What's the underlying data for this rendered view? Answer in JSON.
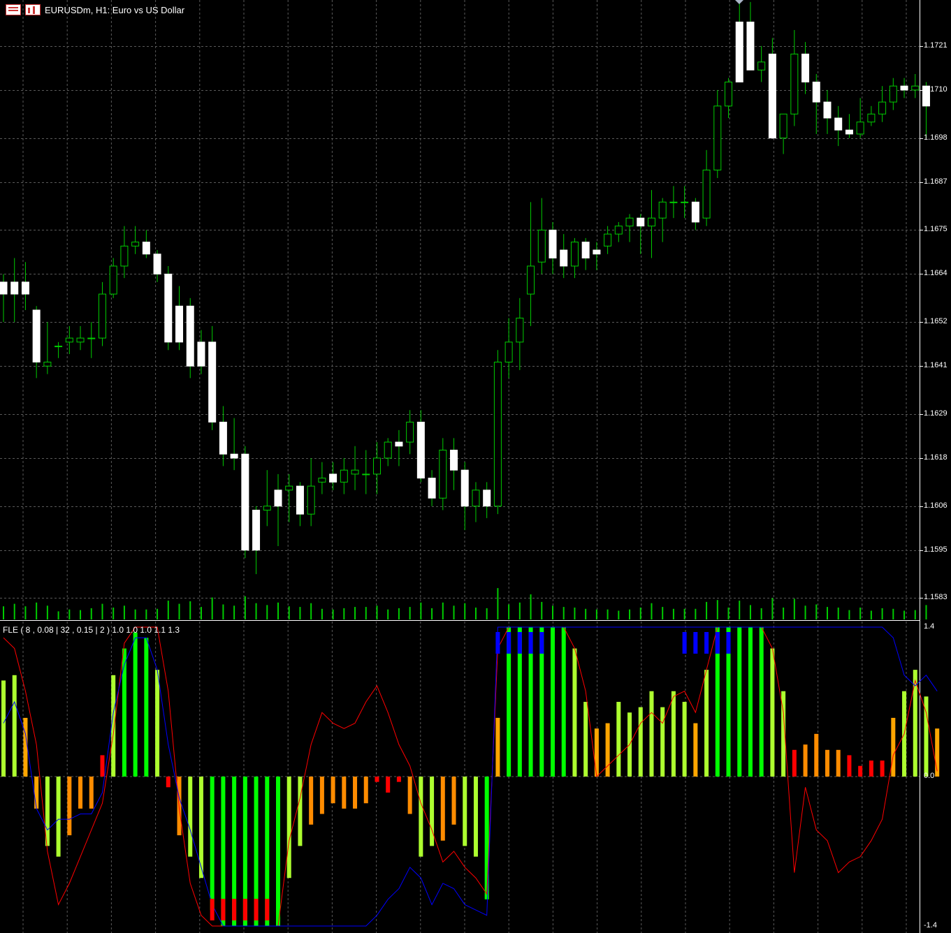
{
  "window": {
    "symbol": "EURUSDm",
    "timeframe": "H1",
    "title": "EURUSDm, H1:  Euro vs US Dollar"
  },
  "indicator": {
    "label": "FLE ( 8 , 0.08 | 32 , 0.15 | 2 ) 1.0 1.0 1.0 1.1 1.3",
    "axis": [
      "1.4",
      "0.0",
      "-1.4"
    ]
  },
  "price_axis": [
    "1.1721",
    "1.1710",
    "1.1698",
    "1.1687",
    "1.1675",
    "1.1664",
    "1.1652",
    "1.1641",
    "1.1629",
    "1.1618",
    "1.1606",
    "1.1595",
    "1.1583"
  ],
  "colors": {
    "background": "#000000",
    "grid": "#5a5a5a",
    "candle_up_body": "#000000",
    "candle_down_body": "#ffffff",
    "candle_wick": "#00cc00",
    "volume": "#00cc00",
    "hist_strong": "#00ff00",
    "hist_mid": "#adff2f",
    "hist_weak": "#ffa500",
    "hist_low": "#ff8c00",
    "hist_neg": "#ff0000",
    "line_red": "#ff0000",
    "line_blue": "#0000ff",
    "marker_buy": "#0000ff",
    "marker_sell": "#ff0000"
  },
  "chart_data": [
    {
      "type": "candlestick",
      "title": "EURUSDm, H1:  Euro vs US Dollar",
      "ylim": [
        1.15775,
        1.17325
      ],
      "y_ticks": [
        1.1721,
        1.171,
        1.1698,
        1.1687,
        1.1675,
        1.1664,
        1.1652,
        1.1641,
        1.1629,
        1.1618,
        1.1606,
        1.1595,
        1.1583
      ],
      "grid": true,
      "candles": [
        [
          1.1662,
          1.1664,
          1.1652,
          1.1659
        ],
        [
          1.1662,
          1.1668,
          1.1652,
          1.1659
        ],
        [
          1.1662,
          1.1667,
          1.1655,
          1.1659
        ],
        [
          1.1655,
          1.1656,
          1.1638,
          1.1642
        ],
        [
          1.1641,
          1.1652,
          1.1639,
          1.1642
        ],
        [
          1.1646,
          1.1647,
          1.1643,
          1.1646
        ],
        [
          1.1647,
          1.1651,
          1.1644,
          1.1648
        ],
        [
          1.1647,
          1.1651,
          1.1645,
          1.1648
        ],
        [
          1.1648,
          1.1652,
          1.1643,
          1.1648
        ],
        [
          1.1648,
          1.1662,
          1.1646,
          1.1659
        ],
        [
          1.1659,
          1.1668,
          1.1658,
          1.1666
        ],
        [
          1.1666,
          1.1676,
          1.1663,
          1.1671
        ],
        [
          1.1671,
          1.1676,
          1.1669,
          1.1672
        ],
        [
          1.1672,
          1.1675,
          1.1668,
          1.1669
        ],
        [
          1.1669,
          1.167,
          1.1662,
          1.1664
        ],
        [
          1.1664,
          1.1666,
          1.1645,
          1.1647
        ],
        [
          1.1656,
          1.1661,
          1.1645,
          1.1647
        ],
        [
          1.1656,
          1.1658,
          1.1638,
          1.1641
        ],
        [
          1.1647,
          1.165,
          1.1639,
          1.1641
        ],
        [
          1.1647,
          1.1651,
          1.1625,
          1.1627
        ],
        [
          1.1627,
          1.1631,
          1.1616,
          1.1619
        ],
        [
          1.1619,
          1.1628,
          1.1615,
          1.1618
        ],
        [
          1.1619,
          1.1621,
          1.1593,
          1.1595
        ],
        [
          1.1605,
          1.1606,
          1.1589,
          1.1595
        ],
        [
          1.1605,
          1.1615,
          1.1601,
          1.1606
        ],
        [
          1.161,
          1.1614,
          1.1596,
          1.1606
        ],
        [
          1.161,
          1.1614,
          1.1602,
          1.1611
        ],
        [
          1.1611,
          1.1612,
          1.1601,
          1.1604
        ],
        [
          1.1604,
          1.1618,
          1.1601,
          1.1611
        ],
        [
          1.1612,
          1.1617,
          1.1609,
          1.1613
        ],
        [
          1.1614,
          1.1617,
          1.161,
          1.1612
        ],
        [
          1.1612,
          1.1618,
          1.1609,
          1.1615
        ],
        [
          1.1614,
          1.1621,
          1.161,
          1.1615
        ],
        [
          1.1614,
          1.162,
          1.1609,
          1.1614
        ],
        [
          1.1614,
          1.1622,
          1.1609,
          1.1618
        ],
        [
          1.1618,
          1.1623,
          1.1616,
          1.1622
        ],
        [
          1.1622,
          1.1625,
          1.1616,
          1.1621
        ],
        [
          1.1622,
          1.163,
          1.1619,
          1.1627
        ],
        [
          1.1627,
          1.163,
          1.1612,
          1.1613
        ],
        [
          1.1613,
          1.1615,
          1.1606,
          1.1608
        ],
        [
          1.1608,
          1.1623,
          1.1605,
          1.162
        ],
        [
          1.162,
          1.1623,
          1.161,
          1.1615
        ],
        [
          1.1615,
          1.1617,
          1.16,
          1.1606
        ],
        [
          1.1606,
          1.1612,
          1.1602,
          1.161
        ],
        [
          1.161,
          1.1612,
          1.1603,
          1.1606
        ],
        [
          1.1606,
          1.1645,
          1.1604,
          1.1642
        ],
        [
          1.1642,
          1.1653,
          1.1638,
          1.1647
        ],
        [
          1.1647,
          1.1658,
          1.164,
          1.1653
        ],
        [
          1.1659,
          1.1682,
          1.1651,
          1.1666
        ],
        [
          1.1667,
          1.1683,
          1.1664,
          1.1675
        ],
        [
          1.1675,
          1.1677,
          1.1664,
          1.1668
        ],
        [
          1.167,
          1.1674,
          1.1663,
          1.1666
        ],
        [
          1.1666,
          1.1673,
          1.1663,
          1.1672
        ],
        [
          1.1672,
          1.1673,
          1.1665,
          1.1668
        ],
        [
          1.167,
          1.1672,
          1.1665,
          1.1669
        ],
        [
          1.1671,
          1.1676,
          1.1669,
          1.1674
        ],
        [
          1.1674,
          1.1677,
          1.1672,
          1.1676
        ],
        [
          1.1676,
          1.1679,
          1.1672,
          1.1678
        ],
        [
          1.1678,
          1.1679,
          1.1669,
          1.1676
        ],
        [
          1.1676,
          1.1685,
          1.1668,
          1.1678
        ],
        [
          1.1678,
          1.1683,
          1.1672,
          1.1682
        ],
        [
          1.1682,
          1.1686,
          1.1678,
          1.1682
        ],
        [
          1.1682,
          1.1686,
          1.1678,
          1.1682
        ],
        [
          1.1682,
          1.1683,
          1.1675,
          1.1677
        ],
        [
          1.1678,
          1.1695,
          1.1676,
          1.169
        ],
        [
          1.169,
          1.171,
          1.1688,
          1.1706
        ],
        [
          1.1706,
          1.1713,
          1.1703,
          1.1712
        ],
        [
          1.1727,
          1.1733,
          1.1712,
          1.1712
        ],
        [
          1.1727,
          1.1732,
          1.1718,
          1.1715
        ],
        [
          1.1715,
          1.1721,
          1.1712,
          1.1717
        ],
        [
          1.1719,
          1.1723,
          1.1698,
          1.1698
        ],
        [
          1.1698,
          1.1704,
          1.1694,
          1.1704
        ],
        [
          1.1704,
          1.1725,
          1.1701,
          1.1719
        ],
        [
          1.1719,
          1.1722,
          1.1709,
          1.1712
        ],
        [
          1.1712,
          1.1714,
          1.1699,
          1.1707
        ],
        [
          1.1707,
          1.171,
          1.1699,
          1.1703
        ],
        [
          1.1703,
          1.1706,
          1.1696,
          1.17
        ],
        [
          1.17,
          1.1704,
          1.1698,
          1.1699
        ],
        [
          1.1699,
          1.1708,
          1.1698,
          1.1702
        ],
        [
          1.1702,
          1.1706,
          1.1701,
          1.1704
        ],
        [
          1.1704,
          1.1711,
          1.1702,
          1.1707
        ],
        [
          1.1707,
          1.1713,
          1.1705,
          1.1711
        ],
        [
          1.1711,
          1.1713,
          1.1708,
          1.171
        ],
        [
          1.171,
          1.1714,
          1.1708,
          1.1711
        ],
        [
          1.1711,
          1.1712,
          1.1698,
          1.1706
        ]
      ]
    },
    {
      "type": "bar",
      "title": "FLE ( 8 , 0.08 | 32 , 0.15 | 2 ) 1.0 1.0 1.0 1.1 1.3",
      "ylim": [
        -1.4,
        1.4
      ],
      "y_ticks": [
        1.4,
        0.0,
        -1.4
      ],
      "histogram": [
        [
          0.9,
          "mid"
        ],
        [
          0.95,
          "mid"
        ],
        [
          0.55,
          "weak"
        ],
        [
          -0.3,
          "weak"
        ],
        [
          -0.65,
          "mid"
        ],
        [
          -0.75,
          "mid"
        ],
        [
          -0.55,
          "low"
        ],
        [
          -0.3,
          "low"
        ],
        [
          -0.3,
          "low"
        ],
        [
          0.2,
          "neg"
        ],
        [
          0.95,
          "mid"
        ],
        [
          1.2,
          "strong"
        ],
        [
          1.35,
          "strong"
        ],
        [
          1.3,
          "strong"
        ],
        [
          1.0,
          "mid"
        ],
        [
          -0.1,
          "neg"
        ],
        [
          -0.55,
          "low"
        ],
        [
          -0.75,
          "mid"
        ],
        [
          -0.95,
          "mid"
        ],
        [
          -1.25,
          "strong"
        ],
        [
          -1.4,
          "strong"
        ],
        [
          -1.4,
          "strong"
        ],
        [
          -1.4,
          "strong"
        ],
        [
          -1.4,
          "strong"
        ],
        [
          -1.4,
          "strong"
        ],
        [
          -1.4,
          "strong"
        ],
        [
          -0.95,
          "mid"
        ],
        [
          -0.65,
          "mid"
        ],
        [
          -0.45,
          "low"
        ],
        [
          -0.35,
          "low"
        ],
        [
          -0.25,
          "low"
        ],
        [
          -0.3,
          "low"
        ],
        [
          -0.3,
          "low"
        ],
        [
          -0.25,
          "low"
        ],
        [
          -0.05,
          "neg"
        ],
        [
          -0.15,
          "neg"
        ],
        [
          -0.05,
          "neg"
        ],
        [
          -0.35,
          "low"
        ],
        [
          -0.75,
          "mid"
        ],
        [
          -0.65,
          "mid"
        ],
        [
          -0.6,
          "low"
        ],
        [
          -0.45,
          "low"
        ],
        [
          -0.65,
          "mid"
        ],
        [
          -0.75,
          "mid"
        ],
        [
          -1.15,
          "strong"
        ],
        [
          0.55,
          "weak"
        ],
        [
          1.4,
          "strong"
        ],
        [
          1.4,
          "strong"
        ],
        [
          1.4,
          "strong"
        ],
        [
          1.4,
          "strong"
        ],
        [
          1.4,
          "strong"
        ],
        [
          1.4,
          "strong"
        ],
        [
          1.2,
          "mid"
        ],
        [
          0.7,
          "mid"
        ],
        [
          0.45,
          "weak"
        ],
        [
          0.5,
          "weak"
        ],
        [
          0.7,
          "mid"
        ],
        [
          0.6,
          "mid"
        ],
        [
          0.65,
          "mid"
        ],
        [
          0.8,
          "mid"
        ],
        [
          0.65,
          "mid"
        ],
        [
          0.8,
          "mid"
        ],
        [
          0.7,
          "mid"
        ],
        [
          0.5,
          "weak"
        ],
        [
          1.0,
          "mid"
        ],
        [
          1.4,
          "strong"
        ],
        [
          1.4,
          "strong"
        ],
        [
          1.4,
          "strong"
        ],
        [
          1.4,
          "strong"
        ],
        [
          1.4,
          "strong"
        ],
        [
          1.2,
          "mid"
        ],
        [
          0.8,
          "mid"
        ],
        [
          0.25,
          "neg"
        ],
        [
          0.3,
          "low"
        ],
        [
          0.4,
          "low"
        ],
        [
          0.25,
          "low"
        ],
        [
          0.25,
          "low"
        ],
        [
          0.2,
          "neg"
        ],
        [
          0.1,
          "neg"
        ],
        [
          0.15,
          "neg"
        ],
        [
          0.15,
          "neg"
        ],
        [
          0.55,
          "weak"
        ],
        [
          0.8,
          "mid"
        ],
        [
          1.0,
          "mid"
        ],
        [
          0.75,
          "mid"
        ],
        [
          0.45,
          "weak"
        ]
      ],
      "red_line": [
        1.3,
        1.2,
        0.8,
        0.3,
        -0.7,
        -1.2,
        -1.0,
        -0.75,
        -0.5,
        -0.25,
        0.4,
        1.25,
        1.4,
        1.4,
        1.4,
        0.8,
        -0.3,
        -1.0,
        -1.3,
        -1.4,
        -1.4,
        -1.4,
        -1.4,
        -1.4,
        -1.4,
        -1.4,
        -0.6,
        -0.2,
        0.3,
        0.6,
        0.5,
        0.45,
        0.5,
        0.7,
        0.85,
        0.6,
        0.3,
        0.1,
        -0.25,
        -0.5,
        -0.8,
        -0.7,
        -0.85,
        -0.95,
        -1.1,
        1.2,
        1.4,
        1.4,
        1.4,
        1.4,
        1.4,
        1.4,
        1.2,
        0.8,
        0.0,
        0.1,
        0.2,
        0.3,
        0.5,
        0.6,
        0.5,
        0.75,
        0.8,
        0.6,
        1.0,
        1.4,
        1.4,
        1.4,
        1.4,
        1.4,
        1.2,
        0.6,
        -0.9,
        -0.1,
        -0.5,
        -0.6,
        -0.9,
        -0.8,
        -0.75,
        -0.6,
        -0.4,
        0.2,
        0.4,
        0.9,
        0.6,
        0.05
      ],
      "blue_line": [
        0.5,
        0.7,
        0.4,
        -0.3,
        -0.5,
        -0.4,
        -0.4,
        -0.35,
        -0.35,
        -0.15,
        0.6,
        1.05,
        1.3,
        1.3,
        1.0,
        0.3,
        -0.2,
        -0.5,
        -0.85,
        -1.2,
        -1.4,
        -1.4,
        -1.4,
        -1.4,
        -1.4,
        -1.4,
        -1.4,
        -1.4,
        -1.4,
        -1.4,
        -1.4,
        -1.4,
        -1.4,
        -1.4,
        -1.3,
        -1.15,
        -1.05,
        -0.85,
        -0.95,
        -1.2,
        -1.0,
        -1.05,
        -1.2,
        -1.25,
        -1.3,
        1.4,
        1.4,
        1.4,
        1.4,
        1.4,
        1.4,
        1.4,
        1.4,
        1.4,
        1.4,
        1.4,
        1.4,
        1.4,
        1.4,
        1.4,
        1.4,
        1.4,
        1.4,
        1.4,
        1.4,
        1.4,
        1.4,
        1.4,
        1.4,
        1.4,
        1.4,
        1.4,
        1.4,
        1.4,
        1.4,
        1.4,
        1.4,
        1.4,
        1.4,
        1.4,
        1.4,
        1.3,
        0.95,
        0.85,
        0.95,
        0.8
      ],
      "buy_markers": [
        45,
        46,
        47,
        48,
        49,
        62,
        63,
        64,
        65,
        66
      ],
      "sell_markers": [
        19,
        20,
        21,
        22,
        23,
        24
      ]
    }
  ]
}
